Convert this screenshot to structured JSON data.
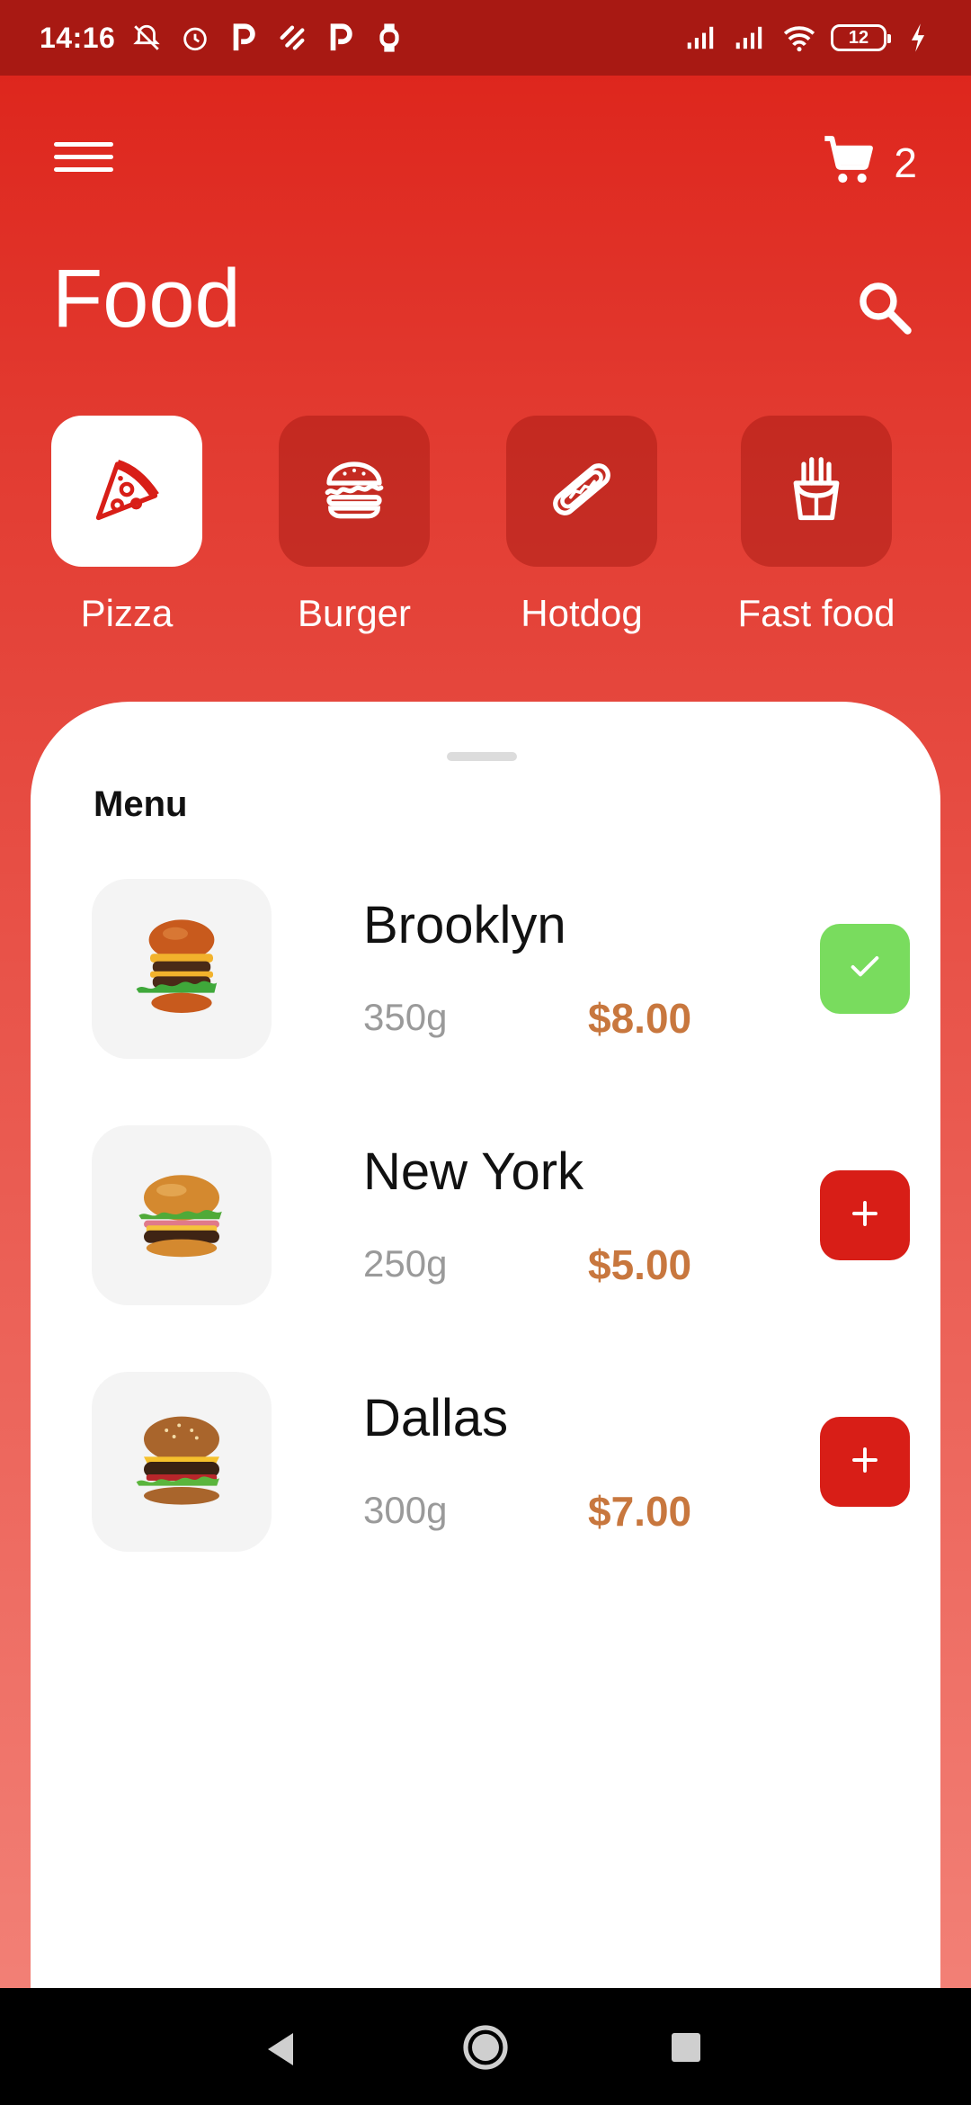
{
  "status_bar": {
    "time": "14:16",
    "battery": "12",
    "icons": [
      "mute-icon",
      "alarm-icon",
      "parking-icon",
      "app-icon",
      "parking-icon",
      "watch-icon",
      "signal-icon",
      "signal-icon",
      "wifi-icon",
      "charging-icon"
    ]
  },
  "topbar": {
    "menu_icon": "hamburger-icon",
    "cart_icon": "cart-icon",
    "cart_count": "2"
  },
  "header": {
    "title": "Food",
    "search_icon": "search-icon"
  },
  "categories": [
    {
      "label": "Pizza",
      "icon": "pizza-icon",
      "active": true
    },
    {
      "label": "Burger",
      "icon": "burger-icon",
      "active": false
    },
    {
      "label": "Hotdog",
      "icon": "hotdog-icon",
      "active": false
    },
    {
      "label": "Fast food",
      "icon": "fries-icon",
      "active": false
    }
  ],
  "menu": {
    "heading": "Menu",
    "items": [
      {
        "name": "Brooklyn",
        "weight": "350g",
        "price": "$8.00",
        "state": "added"
      },
      {
        "name": "New York",
        "weight": "250g",
        "price": "$5.00",
        "state": "add"
      },
      {
        "name": "Dallas",
        "weight": "300g",
        "price": "$7.00",
        "state": "add"
      }
    ]
  },
  "colors": {
    "accent": "#d81e17",
    "status_bar": "#a81913",
    "added": "#79dc5e",
    "price": "#c8773e"
  },
  "nav": {
    "back_icon": "back-icon",
    "home_icon": "home-icon",
    "recent_icon": "recent-apps-icon"
  }
}
